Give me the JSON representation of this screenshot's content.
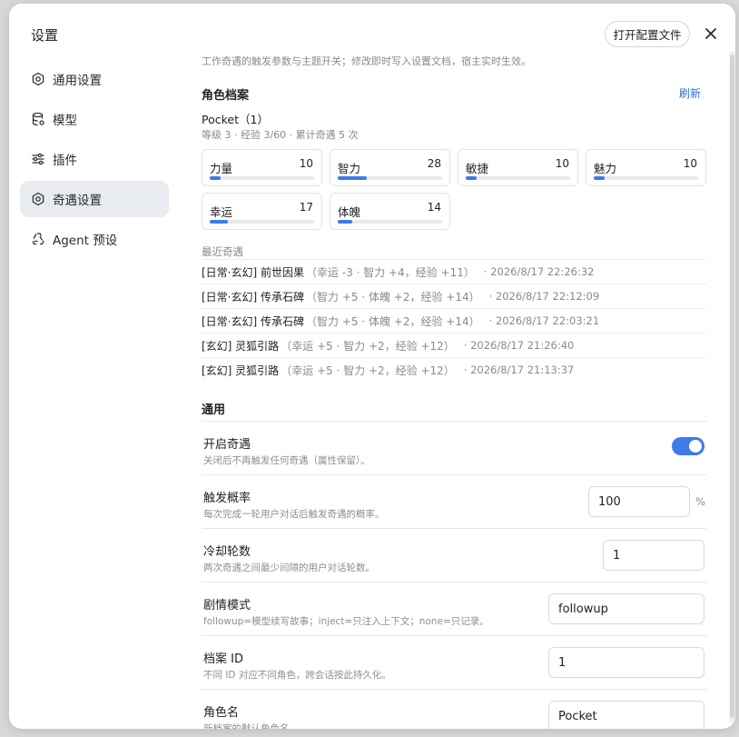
{
  "dialog": {
    "title": "设置",
    "open_config_label": "打开配置文件"
  },
  "sidebar": {
    "items": [
      {
        "label": "通用设置",
        "icon": "gear-icon"
      },
      {
        "label": "模型",
        "icon": "database-icon"
      },
      {
        "label": "插件",
        "icon": "sliders-icon"
      },
      {
        "label": "奇遇设置",
        "icon": "gear-icon",
        "active": true
      },
      {
        "label": "Agent 预设",
        "icon": "recycle-icon"
      }
    ]
  },
  "main": {
    "description": "工作奇遇的触发参数与主题开关；修改即时写入设置文档，宿主实时生效。",
    "profile": {
      "heading": "角色档案",
      "refresh_label": "刷新",
      "name": "Pocket（1）",
      "summary": "等级 3 · 经验 3/60 · 累计奇遇 5 次",
      "stats": [
        {
          "name": "力量",
          "value": "10",
          "level": 0.1
        },
        {
          "name": "智力",
          "value": "28",
          "level": 0.28
        },
        {
          "name": "敏捷",
          "value": "10",
          "level": 0.1
        },
        {
          "name": "魅力",
          "value": "10",
          "level": 0.1
        },
        {
          "name": "幸运",
          "value": "17",
          "level": 0.17
        },
        {
          "name": "体魄",
          "value": "14",
          "level": 0.14
        }
      ]
    },
    "recent": {
      "heading": "最近奇遇",
      "items": [
        {
          "title": "[日常·玄幻] 前世因果",
          "detail": "（幸运 -3 · 智力 +4，经验 +11）",
          "time": "· 2026/8/17 22:26:32"
        },
        {
          "title": "[日常·玄幻] 传承石碑",
          "detail": "（智力 +5 · 体魄 +2，经验 +14）",
          "time": "· 2026/8/17 22:12:09"
        },
        {
          "title": "[日常·玄幻] 传承石碑",
          "detail": "（智力 +5 · 体魄 +2，经验 +14）",
          "time": "· 2026/8/17 22:03:21"
        },
        {
          "title": "[玄幻] 灵狐引路",
          "detail": "（幸运 +5 · 智力 +2，经验 +12）",
          "time": "· 2026/8/17 21:26:40"
        },
        {
          "title": "[玄幻] 灵狐引路",
          "detail": "（幸运 +5 · 智力 +2，经验 +12）",
          "time": "· 2026/8/17 21:13:37"
        }
      ]
    },
    "general": {
      "heading": "通用",
      "enable": {
        "label": "开启奇遇",
        "hint": "关闭后不再触发任何奇遇（属性保留）。",
        "on": true
      },
      "probability": {
        "label": "触发概率",
        "hint": "每次完成一轮用户对话后触发奇遇的概率。",
        "value": "100",
        "unit": "%"
      },
      "cooldown": {
        "label": "冷却轮数",
        "hint": "两次奇遇之间最少间隔的用户对话轮数。",
        "value": "1"
      },
      "story_mode": {
        "label": "剧情模式",
        "hint": "followup=模型续写故事；inject=只注入上下文；none=只记录。",
        "value": "followup"
      },
      "profile_id": {
        "label": "档案 ID",
        "hint": "不同 ID 对应不同角色，跨会话按此持久化。",
        "value": "1"
      },
      "char_name": {
        "label": "角色名",
        "hint": "新档案的默认角色名。",
        "value": "Pocket"
      }
    }
  },
  "colors": {
    "accent": "#3c7be8",
    "active_nav_bg": "#e8ebf0",
    "link": "#2b6fd8"
  }
}
